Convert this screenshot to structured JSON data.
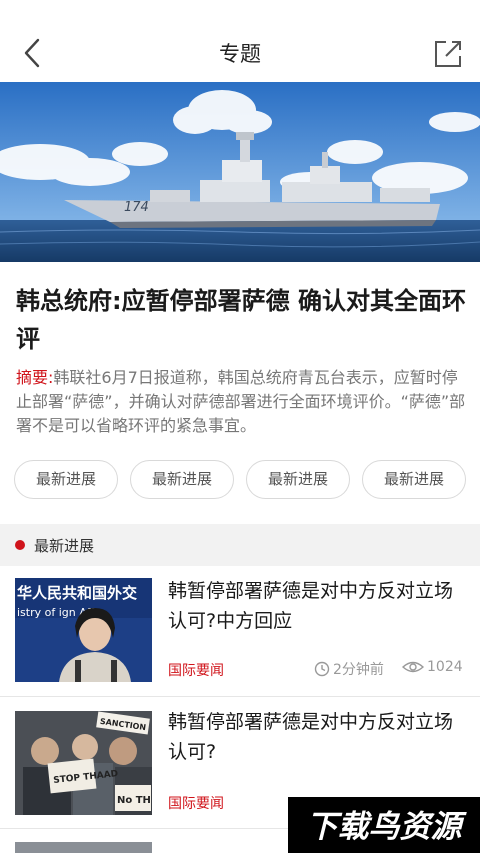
{
  "header": {
    "title": "专题"
  },
  "hero": {
    "ship_number": "174"
  },
  "article": {
    "headline": "韩总统府:应暂停部署萨德 确认对其全面环评",
    "summary_label": "摘要:",
    "summary_text": "韩联社6月7日报道称，韩国总统府青瓦台表示，应暂时停止部署“萨德”，并确认对萨德部署进行全面环境评价。“萨德”部署不是可以省略环评的紧急事宜。"
  },
  "chips": [
    "最新进展",
    "最新进展",
    "最新进展",
    "最新进展"
  ],
  "section": {
    "title": "最新进展"
  },
  "news": [
    {
      "title": "韩暂停部署萨德是对中方反对立场认可?中方回应",
      "category": "国际要闻",
      "time": "2分钟前",
      "views": "1024",
      "thumb_text_top": "华人民共和国外交",
      "thumb_text_sub": "istry of   ign Affa"
    },
    {
      "title": "韩暂停部署萨德是对中方反对立场认可?",
      "category": "国际要闻",
      "thumb_signs": [
        "STOP THAAD",
        "SANCTION",
        "No TH"
      ]
    }
  ],
  "watermark": {
    "text": "下载鸟资源"
  },
  "colors": {
    "accent": "#d0141b",
    "section_bg": "#f2f2f2"
  },
  "icons": {
    "back": "chevron-left-icon",
    "share": "share-icon",
    "clock": "clock-icon",
    "eye": "eye-icon"
  }
}
